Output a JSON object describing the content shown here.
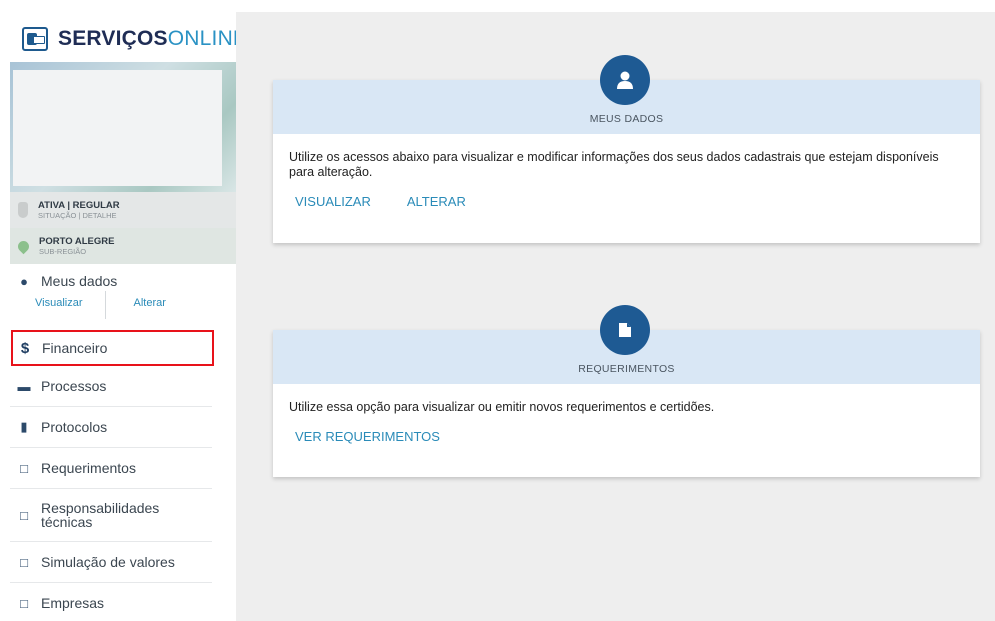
{
  "brand": {
    "part1": "SERVIÇOS",
    "part2": "ONLINE"
  },
  "status": [
    {
      "main": "ATIVA | REGULAR",
      "sub": "SITUAÇÃO | DETALHE"
    },
    {
      "main": "PORTO ALEGRE",
      "sub": "SUB-REGIÃO"
    }
  ],
  "nav": {
    "meus_dados": {
      "label": "Meus dados",
      "visualizar": "Visualizar",
      "alterar": "Alterar"
    },
    "financeiro": "Financeiro",
    "processos": "Processos",
    "protocolos": "Protocolos",
    "requerimentos": "Requerimentos",
    "responsabilidades_1": "Responsabilidades",
    "responsabilidades_2": "técnicas",
    "simulacao": "Simulação de valores",
    "empresas": "Empresas"
  },
  "cards": {
    "meus_dados": {
      "title": "MEUS DADOS",
      "text": "Utilize os acessos abaixo para visualizar e modificar informações dos seus dados cadastrais que estejam disponíveis para alteração.",
      "link1": "VISUALIZAR",
      "link2": "ALTERAR"
    },
    "requerimentos": {
      "title": "REQUERIMENTOS",
      "text": "Utilize essa opção para visualizar ou emitir novos requerimentos e certidões.",
      "link1": "VER REQUERIMENTOS"
    }
  },
  "colors": {
    "accent": "#1e5a93",
    "link": "#2a8bb8",
    "highlight": "#e8121a",
    "header_band": "#d9e7f5"
  }
}
